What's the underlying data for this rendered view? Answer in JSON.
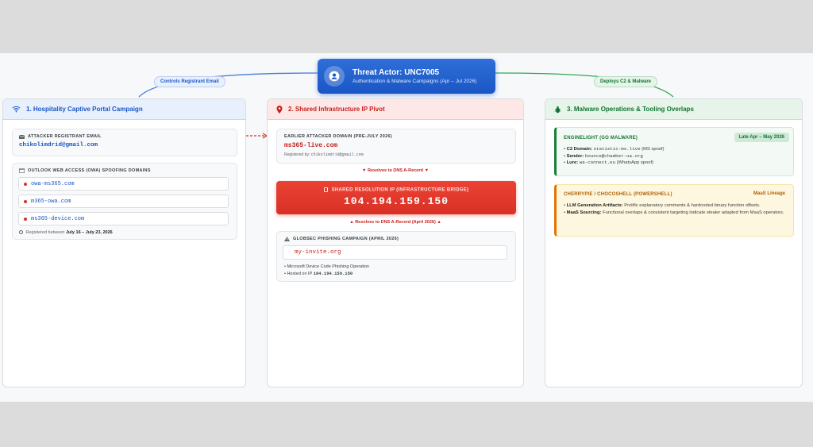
{
  "actor": {
    "title": "Threat Actor: UNC7005",
    "subtitle": "Authentication & Malware Campaigns (Apr – Jul 2026)"
  },
  "connectors": {
    "left_label": "Controls Registrant Email",
    "right_label": "Deploys C2 & Malware"
  },
  "panel1": {
    "title": "1. Hospitality Captive Portal Campaign",
    "email_caption": "ATTACKER REGISTRANT EMAIL",
    "email_value": "chikolimdrid@gmail.com",
    "owa_caption": "OUTLOOK WEB ACCESS (OWA) SPOOFING DOMAINS",
    "domains": [
      "owa-ms365.com",
      "m365-owa.com",
      "ms365-device.com"
    ],
    "date_prefix": "Registered between",
    "date_range": "July 16 – July 23, 2026"
  },
  "panel2": {
    "title": "2. Shared Infrastructure IP Pivot",
    "earlier_caption": "EARLIER ATTACKER DOMAIN (PRE-JULY 2026)",
    "earlier_domain": "ms365-live.com",
    "registered_by_label": "Registered by:",
    "registered_by_value": "chikolimdrid@gmail.com",
    "resolves_1": "Resolves to DNS A-Record",
    "bridge_caption": "SHARED RESOLUTION IP (INFRASTRUCTURE BRIDGE)",
    "bridge_ip": "104.194.159.150",
    "resolves_2": "Resolves to DNS A-Record (April 2026)",
    "globsec_caption": "GLOBSEC PHISHING CAMPAIGN (APRIL 2026)",
    "invite_domain": "my-invite.org",
    "bullet_1": "• Microsoft Device Code Phishing Operation",
    "bullet_2_prefix": "• Hosted on IP",
    "bullet_2_ip": "104.194.159.150"
  },
  "panel3": {
    "title": "3. Malware Operations & Tooling Overlaps",
    "card1": {
      "title": "ENGINELIGHT (GO MALWARE)",
      "badge": "Late Apr – May 2026",
      "c2_label": "C2 Domain:",
      "c2_value": "statistic-ms.live",
      "c2_note": "(MS spoof)",
      "sender_label": "Sender:",
      "sender_value": "bounce@chamber-ua.org",
      "lure_label": "Lure:",
      "lure_value": "wa-connect.eu",
      "lure_note": "(WhatsApp spoof)"
    },
    "card2": {
      "title": "CHERRYPIE / CHOCOSHELL (POWERSHELL)",
      "badge": "MaaS Lineage",
      "llm_label": "LLM Generation Artifacts:",
      "llm_text": "Prolific explanatory comments & hardcoded binary function offsets.",
      "maas_label": "MaaS Sourcing:",
      "maas_text": "Functional overlaps & consistent targeting indicate stealer adapted from MaaS operators."
    }
  },
  "colors": {
    "blue": "#1a56c4",
    "red": "#d93025",
    "green": "#188038",
    "amber": "#e37400"
  }
}
